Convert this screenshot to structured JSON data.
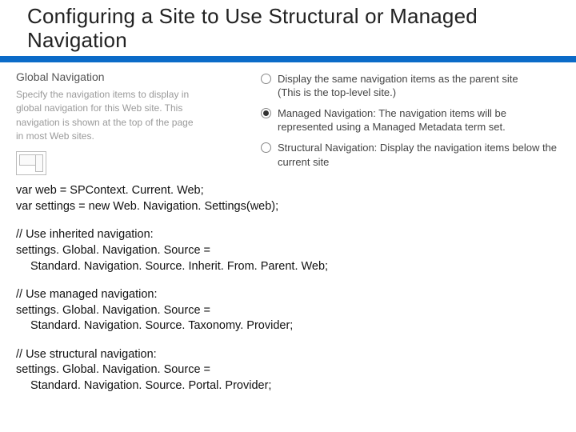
{
  "title": "Configuring a Site to Use Structural or Managed Navigation",
  "settings": {
    "section_title": "Global Navigation",
    "description": "Specify the navigation items to display in global navigation for this Web site. This navigation is shown at the top of the page in most Web sites.",
    "options": [
      {
        "label": "Display the same navigation items as the parent site",
        "sub": "(This is the top-level site.)",
        "checked": false
      },
      {
        "label": "Managed Navigation: The navigation items will be represented using a Managed Metadata term set.",
        "sub": "",
        "checked": true
      },
      {
        "label": "Structural Navigation: Display the navigation items below the current site",
        "sub": "",
        "checked": false
      }
    ]
  },
  "code": {
    "l1": "var web = SPContext. Current. Web;",
    "l2": "var settings = new Web. Navigation. Settings(web);",
    "c1a": "// Use inherited navigation:",
    "c1b": "settings. Global. Navigation. Source =",
    "c1c": "Standard. Navigation. Source. Inherit. From. Parent. Web;",
    "c2a": "// Use managed navigation:",
    "c2b": "settings. Global. Navigation. Source =",
    "c2c": "Standard. Navigation. Source. Taxonomy. Provider;",
    "c3a": "// Use structural navigation:",
    "c3b": "settings. Global. Navigation. Source =",
    "c3c": "Standard. Navigation. Source. Portal. Provider;"
  }
}
